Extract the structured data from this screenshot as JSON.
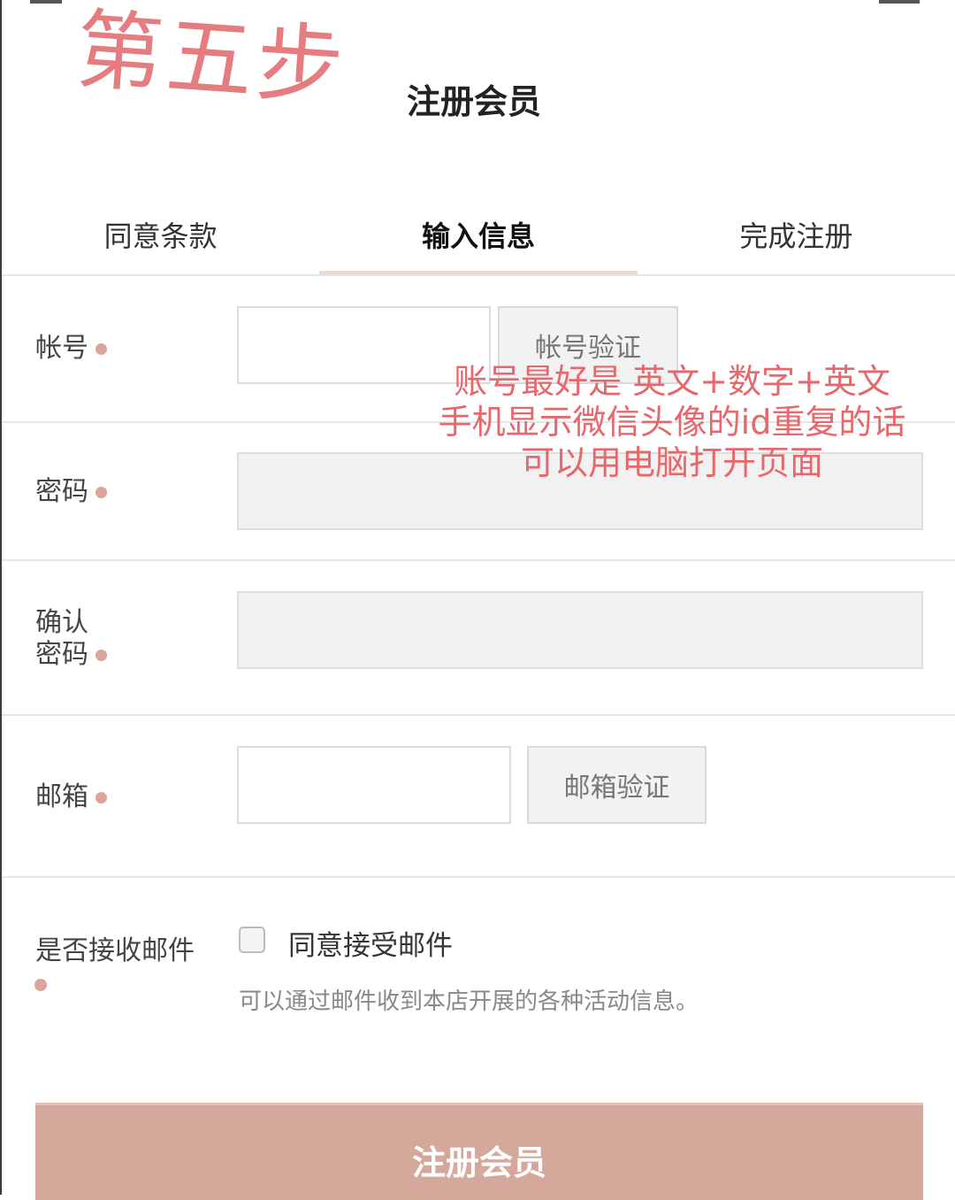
{
  "annotation": {
    "step": "第五步",
    "note_lines": [
      "账号最好是 英文+数字+英文",
      "手机显示微信头像的id重复的话",
      "可以用电脑打开页面"
    ]
  },
  "header": {
    "title": "注册会员"
  },
  "tabs": [
    {
      "label": "同意条款",
      "active": false
    },
    {
      "label": "输入信息",
      "active": true
    },
    {
      "label": "完成注册",
      "active": false
    }
  ],
  "form": {
    "account": {
      "label": "帐号",
      "value": "",
      "verify_label": "帐号验证"
    },
    "password": {
      "label": "密码",
      "value": ""
    },
    "confirm_password": {
      "label_line1": "确认",
      "label_line2": "密码",
      "value": ""
    },
    "email": {
      "label": "邮箱",
      "value": "",
      "verify_label": "邮箱验证"
    },
    "mail_subscribe": {
      "label": "是否接收邮件",
      "checkbox_label": "同意接受邮件",
      "checked": false,
      "hint": "可以通过邮件收到本店开展的各种活动信息。"
    }
  },
  "submit_label": "注册会员",
  "colors": {
    "annotation": "#e57c80",
    "required_dot": "#dca49a",
    "active_tab_underline": "#f0d8cc",
    "submit_bg": "#d5a89c"
  }
}
